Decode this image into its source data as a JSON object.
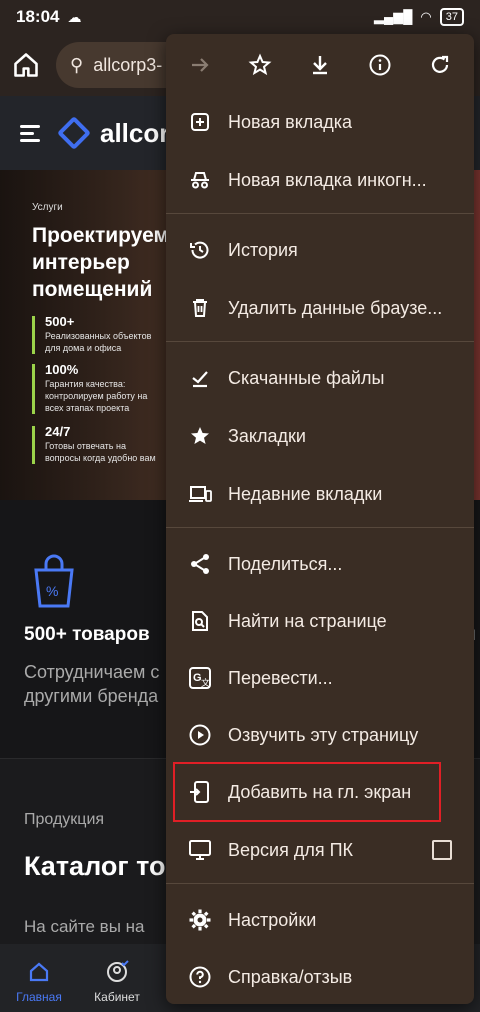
{
  "status": {
    "time": "18:04",
    "battery": "37"
  },
  "browser": {
    "url": "allcorp3-"
  },
  "site": {
    "logo_text": "allcor",
    "hero": {
      "tag": "Услуги",
      "title": "Проектируем интерьер помещений",
      "stats": [
        {
          "value": "500+",
          "text": "Реализованных объектов для дома и офиса"
        },
        {
          "value": "100%",
          "text": "Гарантия качества: контролируем работу на всех этапах проекта"
        },
        {
          "value": "24/7",
          "text": "Готовы отвечать на вопросы когда удобно вам"
        }
      ]
    },
    "feature": {
      "title": "500+ товаров",
      "desc": "Сотрудничаем с другими бренда",
      "edge": "й"
    },
    "catalog": {
      "eyebrow": "Продукция",
      "title": "Каталог то",
      "desc": "На сайте вы на"
    },
    "nav": [
      {
        "label": "Главная",
        "icon": "home-icon",
        "active": true
      },
      {
        "label": "Кабинет",
        "icon": "account-icon",
        "active": false
      }
    ]
  },
  "menu": {
    "toolbar": [
      {
        "name": "forward-button",
        "icon": "arrow-forward-icon"
      },
      {
        "name": "bookmark-button",
        "icon": "star-outline-icon"
      },
      {
        "name": "download-button",
        "icon": "download-icon"
      },
      {
        "name": "info-button",
        "icon": "info-icon"
      },
      {
        "name": "reload-button",
        "icon": "reload-icon"
      }
    ],
    "items": {
      "new_tab": "Новая вкладка",
      "incognito": "Новая вкладка инкогн...",
      "history": "История",
      "clear_data": "Удалить данные браузе...",
      "downloads": "Скачанные файлы",
      "bookmarks": "Закладки",
      "recent_tabs": "Недавние вкладки",
      "share": "Поделиться...",
      "find": "Найти на странице",
      "translate": "Перевести...",
      "read_aloud": "Озвучить эту страницу",
      "add_home": "Добавить на гл. экран",
      "desktop": "Версия для ПК",
      "settings": "Настройки",
      "help": "Справка/отзыв"
    },
    "highlight_color": "#e01f26"
  }
}
